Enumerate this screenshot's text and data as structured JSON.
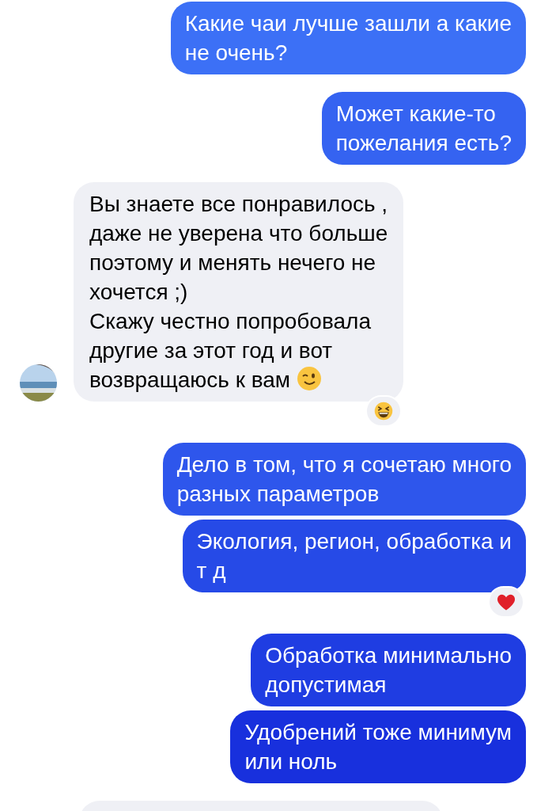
{
  "groups": [
    {
      "kind": "sent",
      "messages": [
        {
          "text": "Какие чаи лучше зашли а какие\nне очень?"
        }
      ]
    },
    {
      "kind": "sent",
      "messages": [
        {
          "text": "Может какие-то\nпожелания есть?"
        }
      ]
    },
    {
      "kind": "received",
      "messages": [
        {
          "text": "Вы знаете все понравилось ,\nдаже не уверена что больше\nпоэтому и менять нечего не\nхочется ;)\nСкажу честно попробовала\nдругие за этот год и вот\nвозвращаюсь к вам",
          "emoji": {
            "kind": "wink"
          },
          "reaction": {
            "kind": "laugh"
          }
        }
      ]
    },
    {
      "kind": "sent",
      "messages": [
        {
          "text": "Дело в том, что я сочетаю много\nразных параметров"
        },
        {
          "text": "Экология, регион, обработка и\nт д",
          "reaction": {
            "kind": "heart"
          }
        }
      ]
    },
    {
      "kind": "sent",
      "messages": [
        {
          "text": "Обработка минимально\nдопустимая"
        },
        {
          "text": "Удобрений тоже минимум\nили ноль"
        }
      ]
    },
    {
      "kind": "received-cut"
    }
  ]
}
